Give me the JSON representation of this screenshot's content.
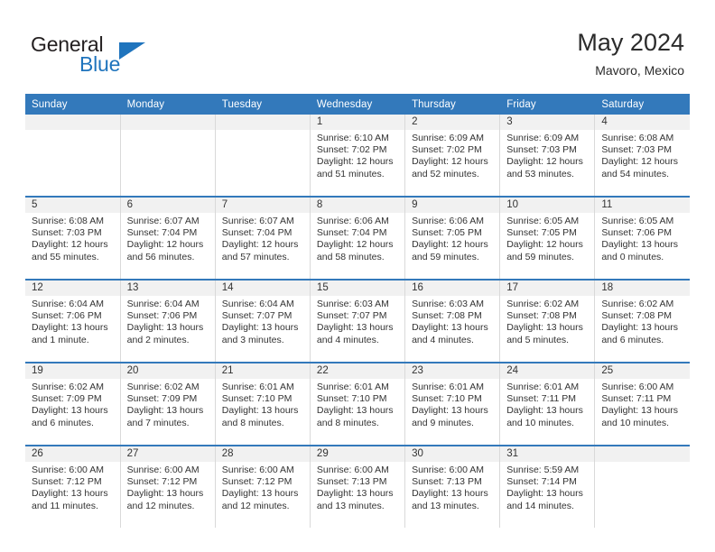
{
  "brand": {
    "name_top": "General",
    "name_bottom": "Blue",
    "logo_icon": "blue-triangle-logo"
  },
  "header": {
    "month_title": "May 2024",
    "location": "Mavoro, Mexico"
  },
  "colors": {
    "header_blue": "#3379bb",
    "brand_blue": "#1f74bd",
    "daynum_band": "#f1f1f1",
    "cell_border": "#d9d9d9",
    "text": "#333333"
  },
  "calendar": {
    "weekday_headers": [
      "Sunday",
      "Monday",
      "Tuesday",
      "Wednesday",
      "Thursday",
      "Friday",
      "Saturday"
    ],
    "labels": {
      "sunrise": "Sunrise:",
      "sunset": "Sunset:",
      "daylight": "Daylight:"
    },
    "weeks": [
      [
        {
          "day": "",
          "empty": true,
          "sunrise": "",
          "sunset": "",
          "daylight_1": "",
          "daylight_2": ""
        },
        {
          "day": "",
          "empty": true,
          "sunrise": "",
          "sunset": "",
          "daylight_1": "",
          "daylight_2": ""
        },
        {
          "day": "",
          "empty": true,
          "sunrise": "",
          "sunset": "",
          "daylight_1": "",
          "daylight_2": ""
        },
        {
          "day": "1",
          "empty": false,
          "sunrise": "Sunrise: 6:10 AM",
          "sunset": "Sunset: 7:02 PM",
          "daylight_1": "Daylight: 12 hours",
          "daylight_2": "and 51 minutes."
        },
        {
          "day": "2",
          "empty": false,
          "sunrise": "Sunrise: 6:09 AM",
          "sunset": "Sunset: 7:02 PM",
          "daylight_1": "Daylight: 12 hours",
          "daylight_2": "and 52 minutes."
        },
        {
          "day": "3",
          "empty": false,
          "sunrise": "Sunrise: 6:09 AM",
          "sunset": "Sunset: 7:03 PM",
          "daylight_1": "Daylight: 12 hours",
          "daylight_2": "and 53 minutes."
        },
        {
          "day": "4",
          "empty": false,
          "sunrise": "Sunrise: 6:08 AM",
          "sunset": "Sunset: 7:03 PM",
          "daylight_1": "Daylight: 12 hours",
          "daylight_2": "and 54 minutes."
        }
      ],
      [
        {
          "day": "5",
          "empty": false,
          "sunrise": "Sunrise: 6:08 AM",
          "sunset": "Sunset: 7:03 PM",
          "daylight_1": "Daylight: 12 hours",
          "daylight_2": "and 55 minutes."
        },
        {
          "day": "6",
          "empty": false,
          "sunrise": "Sunrise: 6:07 AM",
          "sunset": "Sunset: 7:04 PM",
          "daylight_1": "Daylight: 12 hours",
          "daylight_2": "and 56 minutes."
        },
        {
          "day": "7",
          "empty": false,
          "sunrise": "Sunrise: 6:07 AM",
          "sunset": "Sunset: 7:04 PM",
          "daylight_1": "Daylight: 12 hours",
          "daylight_2": "and 57 minutes."
        },
        {
          "day": "8",
          "empty": false,
          "sunrise": "Sunrise: 6:06 AM",
          "sunset": "Sunset: 7:04 PM",
          "daylight_1": "Daylight: 12 hours",
          "daylight_2": "and 58 minutes."
        },
        {
          "day": "9",
          "empty": false,
          "sunrise": "Sunrise: 6:06 AM",
          "sunset": "Sunset: 7:05 PM",
          "daylight_1": "Daylight: 12 hours",
          "daylight_2": "and 59 minutes."
        },
        {
          "day": "10",
          "empty": false,
          "sunrise": "Sunrise: 6:05 AM",
          "sunset": "Sunset: 7:05 PM",
          "daylight_1": "Daylight: 12 hours",
          "daylight_2": "and 59 minutes."
        },
        {
          "day": "11",
          "empty": false,
          "sunrise": "Sunrise: 6:05 AM",
          "sunset": "Sunset: 7:06 PM",
          "daylight_1": "Daylight: 13 hours",
          "daylight_2": "and 0 minutes."
        }
      ],
      [
        {
          "day": "12",
          "empty": false,
          "sunrise": "Sunrise: 6:04 AM",
          "sunset": "Sunset: 7:06 PM",
          "daylight_1": "Daylight: 13 hours",
          "daylight_2": "and 1 minute."
        },
        {
          "day": "13",
          "empty": false,
          "sunrise": "Sunrise: 6:04 AM",
          "sunset": "Sunset: 7:06 PM",
          "daylight_1": "Daylight: 13 hours",
          "daylight_2": "and 2 minutes."
        },
        {
          "day": "14",
          "empty": false,
          "sunrise": "Sunrise: 6:04 AM",
          "sunset": "Sunset: 7:07 PM",
          "daylight_1": "Daylight: 13 hours",
          "daylight_2": "and 3 minutes."
        },
        {
          "day": "15",
          "empty": false,
          "sunrise": "Sunrise: 6:03 AM",
          "sunset": "Sunset: 7:07 PM",
          "daylight_1": "Daylight: 13 hours",
          "daylight_2": "and 4 minutes."
        },
        {
          "day": "16",
          "empty": false,
          "sunrise": "Sunrise: 6:03 AM",
          "sunset": "Sunset: 7:08 PM",
          "daylight_1": "Daylight: 13 hours",
          "daylight_2": "and 4 minutes."
        },
        {
          "day": "17",
          "empty": false,
          "sunrise": "Sunrise: 6:02 AM",
          "sunset": "Sunset: 7:08 PM",
          "daylight_1": "Daylight: 13 hours",
          "daylight_2": "and 5 minutes."
        },
        {
          "day": "18",
          "empty": false,
          "sunrise": "Sunrise: 6:02 AM",
          "sunset": "Sunset: 7:08 PM",
          "daylight_1": "Daylight: 13 hours",
          "daylight_2": "and 6 minutes."
        }
      ],
      [
        {
          "day": "19",
          "empty": false,
          "sunrise": "Sunrise: 6:02 AM",
          "sunset": "Sunset: 7:09 PM",
          "daylight_1": "Daylight: 13 hours",
          "daylight_2": "and 6 minutes."
        },
        {
          "day": "20",
          "empty": false,
          "sunrise": "Sunrise: 6:02 AM",
          "sunset": "Sunset: 7:09 PM",
          "daylight_1": "Daylight: 13 hours",
          "daylight_2": "and 7 minutes."
        },
        {
          "day": "21",
          "empty": false,
          "sunrise": "Sunrise: 6:01 AM",
          "sunset": "Sunset: 7:10 PM",
          "daylight_1": "Daylight: 13 hours",
          "daylight_2": "and 8 minutes."
        },
        {
          "day": "22",
          "empty": false,
          "sunrise": "Sunrise: 6:01 AM",
          "sunset": "Sunset: 7:10 PM",
          "daylight_1": "Daylight: 13 hours",
          "daylight_2": "and 8 minutes."
        },
        {
          "day": "23",
          "empty": false,
          "sunrise": "Sunrise: 6:01 AM",
          "sunset": "Sunset: 7:10 PM",
          "daylight_1": "Daylight: 13 hours",
          "daylight_2": "and 9 minutes."
        },
        {
          "day": "24",
          "empty": false,
          "sunrise": "Sunrise: 6:01 AM",
          "sunset": "Sunset: 7:11 PM",
          "daylight_1": "Daylight: 13 hours",
          "daylight_2": "and 10 minutes."
        },
        {
          "day": "25",
          "empty": false,
          "sunrise": "Sunrise: 6:00 AM",
          "sunset": "Sunset: 7:11 PM",
          "daylight_1": "Daylight: 13 hours",
          "daylight_2": "and 10 minutes."
        }
      ],
      [
        {
          "day": "26",
          "empty": false,
          "sunrise": "Sunrise: 6:00 AM",
          "sunset": "Sunset: 7:12 PM",
          "daylight_1": "Daylight: 13 hours",
          "daylight_2": "and 11 minutes."
        },
        {
          "day": "27",
          "empty": false,
          "sunrise": "Sunrise: 6:00 AM",
          "sunset": "Sunset: 7:12 PM",
          "daylight_1": "Daylight: 13 hours",
          "daylight_2": "and 12 minutes."
        },
        {
          "day": "28",
          "empty": false,
          "sunrise": "Sunrise: 6:00 AM",
          "sunset": "Sunset: 7:12 PM",
          "daylight_1": "Daylight: 13 hours",
          "daylight_2": "and 12 minutes."
        },
        {
          "day": "29",
          "empty": false,
          "sunrise": "Sunrise: 6:00 AM",
          "sunset": "Sunset: 7:13 PM",
          "daylight_1": "Daylight: 13 hours",
          "daylight_2": "and 13 minutes."
        },
        {
          "day": "30",
          "empty": false,
          "sunrise": "Sunrise: 6:00 AM",
          "sunset": "Sunset: 7:13 PM",
          "daylight_1": "Daylight: 13 hours",
          "daylight_2": "and 13 minutes."
        },
        {
          "day": "31",
          "empty": false,
          "sunrise": "Sunrise: 5:59 AM",
          "sunset": "Sunset: 7:14 PM",
          "daylight_1": "Daylight: 13 hours",
          "daylight_2": "and 14 minutes."
        },
        {
          "day": "",
          "empty": true,
          "sunrise": "",
          "sunset": "",
          "daylight_1": "",
          "daylight_2": ""
        }
      ]
    ]
  }
}
